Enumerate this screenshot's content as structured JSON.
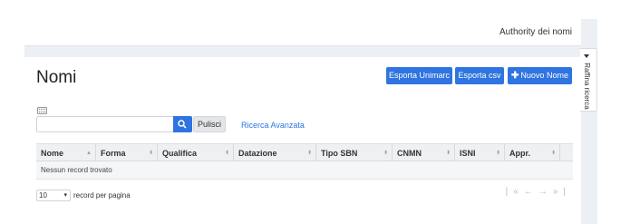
{
  "header": {
    "breadcrumb": "Authority dei nomi"
  },
  "page": {
    "title": "Nomi"
  },
  "actions": {
    "export_unimarc": "Esporta Unimarc",
    "export_csv": "Esporta csv",
    "new_name": "Nuovo Nome",
    "new_name_icon": "plus-icon"
  },
  "search": {
    "value": "",
    "placeholder": "",
    "clear_label": "Pulisci",
    "advanced_label": "Ricerca Avanzata",
    "keyboard_icon": "keyboard-icon",
    "search_icon": "search-icon"
  },
  "table": {
    "columns": [
      "Nome",
      "Forma",
      "Qualifica",
      "Datazione",
      "Tipo SBN",
      "CNMN",
      "ISNI",
      "Appr."
    ],
    "empty_message": "Nessun record trovato"
  },
  "pagination": {
    "page_size": "10",
    "page_size_label": "record per pagina",
    "first": "|«",
    "prev": "←",
    "next": "→",
    "last": "»|"
  },
  "side_panel": {
    "label": "Raffina ricerca",
    "icon": "filter-icon"
  },
  "colors": {
    "primary": "#2f74e0",
    "header_bg": "#eef0f2",
    "frame_bg": "#eceff3"
  }
}
